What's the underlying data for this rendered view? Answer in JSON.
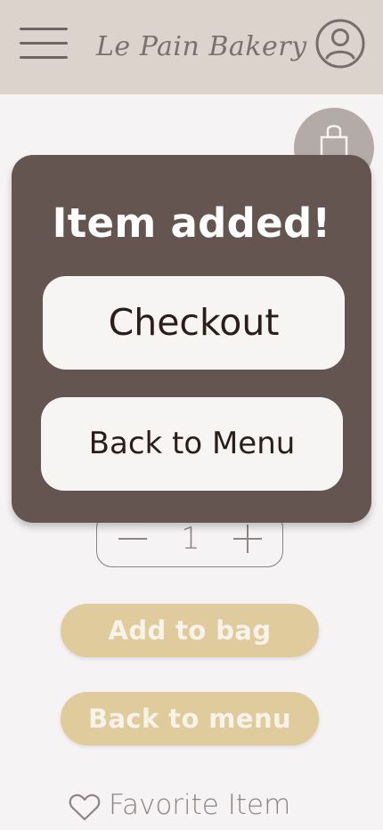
{
  "header": {
    "brand": "Le Pain Bakery",
    "menu_icon": "menu-icon",
    "profile_icon": "profile-icon"
  },
  "bag": {
    "icon": "shopping-bag-icon"
  },
  "product": {
    "quantity": "1",
    "add_to_bag": "Add to bag",
    "back_to_menu": "Back to menu",
    "favorite": "Favorite Item",
    "favorite_icon": "heart-icon"
  },
  "modal": {
    "title": "Item added!",
    "checkout": "Checkout",
    "back": "Back to Menu"
  },
  "colors": {
    "header": "#ddd3cd",
    "modal": "#655550",
    "gold_button": "#dfcb9c",
    "page": "#f6f3f4"
  }
}
